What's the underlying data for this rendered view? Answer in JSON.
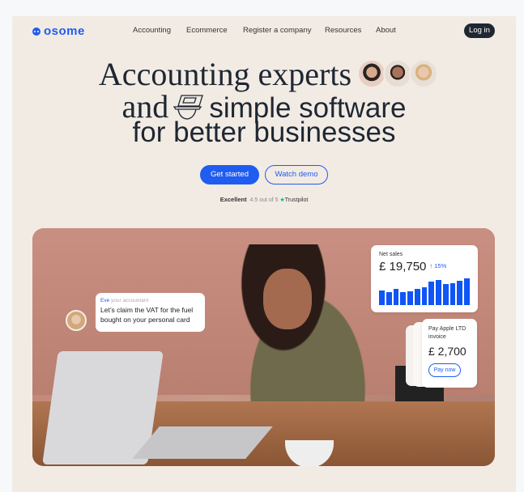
{
  "brand": {
    "name": "osome",
    "color": "#1f5cf0"
  },
  "nav": {
    "items": [
      "Accounting",
      "Ecommerce",
      "Register a company",
      "Resources",
      "About"
    ],
    "login": "Log in"
  },
  "hero": {
    "line1": "Accounting experts",
    "line2_serif": "and",
    "line2_sans": "simple software",
    "line3": "for better businesses"
  },
  "cta": {
    "primary": "Get started",
    "secondary": "Watch demo"
  },
  "trustpilot": {
    "rating_word": "Excellent",
    "score": "4.5 out of 5",
    "brand": "Trustpilot"
  },
  "chat": {
    "name": "Eve",
    "role": "your accountant",
    "message": "Let’s claim the VAT for the fuel bought on your personal card"
  },
  "net_sales": {
    "label": "Net sales",
    "value": "£ 19,750",
    "change": "↑ 15%",
    "bar_levels": [
      0.56,
      0.48,
      0.62,
      0.48,
      0.53,
      0.62,
      0.68,
      0.88,
      0.94,
      0.78,
      0.83,
      0.91,
      1.0
    ]
  },
  "invoice": {
    "title": "Pay Apple LTD invoice",
    "amount": "£ 2,700",
    "button": "Pay now"
  }
}
